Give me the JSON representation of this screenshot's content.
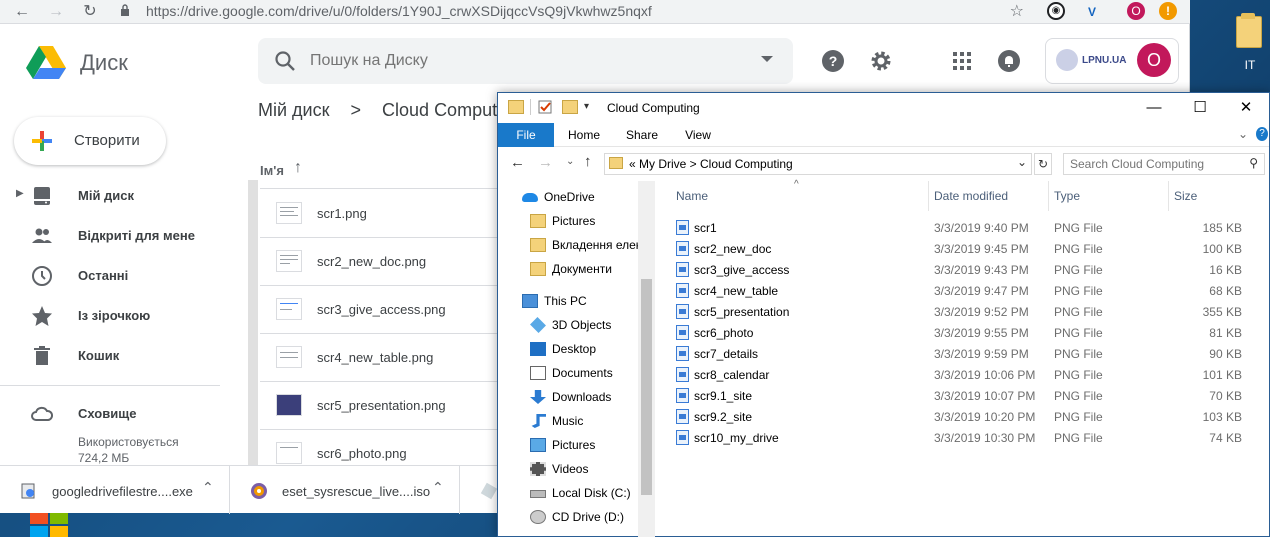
{
  "browser": {
    "url": "https://drive.google.com/drive/u/0/folders/1Y90J_crwXSDijqccVsQ9jVkwhwz5nqxf",
    "profile_initial": "O",
    "alert_badge": "!"
  },
  "drive": {
    "app_title": "Диск",
    "search_placeholder": "Пошук на Диску",
    "org_label": "LPNU.UA",
    "avatar_initial": "O",
    "new_button": "Створити",
    "sidebar": [
      {
        "label": "Мій диск",
        "icon": "drive-icon"
      },
      {
        "label": "Відкриті для мене",
        "icon": "people-icon"
      },
      {
        "label": "Останні",
        "icon": "clock-icon"
      },
      {
        "label": "Із зірочкою",
        "icon": "star-icon"
      },
      {
        "label": "Кошик",
        "icon": "trash-icon"
      }
    ],
    "storage": {
      "label": "Сховище",
      "used_line1": "Використовується",
      "used_line2": "724,2 МБ"
    },
    "breadcrumb": [
      "Мій диск",
      ">",
      "Cloud Computing"
    ],
    "column_name": "Ім'я",
    "files": [
      "scr1.png",
      "scr2_new_doc.png",
      "scr3_give_access.png",
      "scr4_new_table.png",
      "scr5_presentation.png",
      "scr6_photo.png"
    ]
  },
  "downloads": [
    {
      "name": "googledrivefilestre....exe"
    },
    {
      "name": "eset_sysrescue_live....iso"
    }
  ],
  "explorer": {
    "title": "Cloud Computing",
    "ribbon_tabs": [
      "File",
      "Home",
      "Share",
      "View"
    ],
    "address_path": "«  My Drive  >  Cloud Computing",
    "search_placeholder": "Search Cloud Computing",
    "nav": [
      {
        "label": "OneDrive",
        "icon": "onedrive-icon",
        "level": 0
      },
      {
        "label": "Pictures",
        "icon": "folder-icon",
        "level": 1
      },
      {
        "label": "Вкладення елек",
        "icon": "folder-icon",
        "level": 1
      },
      {
        "label": "Документи",
        "icon": "folder-icon",
        "level": 1
      },
      {
        "label": "This PC",
        "icon": "computer-icon",
        "level": 0
      },
      {
        "label": "3D Objects",
        "icon": "cube-icon",
        "level": 1
      },
      {
        "label": "Desktop",
        "icon": "desktop-icon",
        "level": 1
      },
      {
        "label": "Documents",
        "icon": "documents-icon",
        "level": 1
      },
      {
        "label": "Downloads",
        "icon": "download-arrow-icon",
        "level": 1
      },
      {
        "label": "Music",
        "icon": "music-icon",
        "level": 1
      },
      {
        "label": "Pictures",
        "icon": "pictures-icon",
        "level": 1
      },
      {
        "label": "Videos",
        "icon": "videos-icon",
        "level": 1
      },
      {
        "label": "Local Disk (C:)",
        "icon": "disk-icon",
        "level": 1
      },
      {
        "label": "CD Drive (D:)",
        "icon": "cd-icon",
        "level": 1
      }
    ],
    "columns": [
      "Name",
      "Date modified",
      "Type",
      "Size"
    ],
    "files": [
      {
        "name": "scr1",
        "date": "3/3/2019 9:40 PM",
        "type": "PNG File",
        "size": "185 KB"
      },
      {
        "name": "scr2_new_doc",
        "date": "3/3/2019 9:45 PM",
        "type": "PNG File",
        "size": "100 KB"
      },
      {
        "name": "scr3_give_access",
        "date": "3/3/2019 9:43 PM",
        "type": "PNG File",
        "size": "16 KB"
      },
      {
        "name": "scr4_new_table",
        "date": "3/3/2019 9:47 PM",
        "type": "PNG File",
        "size": "68 KB"
      },
      {
        "name": "scr5_presentation",
        "date": "3/3/2019 9:52 PM",
        "type": "PNG File",
        "size": "355 KB"
      },
      {
        "name": "scr6_photo",
        "date": "3/3/2019 9:55 PM",
        "type": "PNG File",
        "size": "81 KB"
      },
      {
        "name": "scr7_details",
        "date": "3/3/2019 9:59 PM",
        "type": "PNG File",
        "size": "90 KB"
      },
      {
        "name": "scr8_calendar",
        "date": "3/3/2019 10:06 PM",
        "type": "PNG File",
        "size": "101 KB"
      },
      {
        "name": "scr9.1_site",
        "date": "3/3/2019 10:07 PM",
        "type": "PNG File",
        "size": "70 KB"
      },
      {
        "name": "scr9.2_site",
        "date": "3/3/2019 10:20 PM",
        "type": "PNG File",
        "size": "103 KB"
      },
      {
        "name": "scr10_my_drive",
        "date": "3/3/2019 10:30 PM",
        "type": "PNG File",
        "size": "74 KB"
      }
    ]
  },
  "desktop": {
    "icon_label": "IT"
  },
  "colors": {
    "drive_accent": "#1a73e8",
    "avatar": "#c2185b",
    "explorer_file_tab": "#1979ca"
  }
}
